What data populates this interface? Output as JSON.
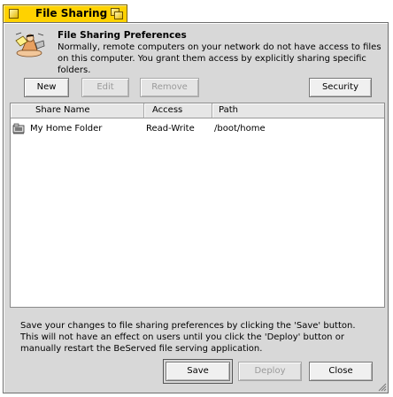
{
  "window": {
    "title": "File Sharing"
  },
  "header": {
    "title": "File Sharing Preferences",
    "description": "Normally, remote computers on your network do not have access to files on this computer.  You grant them access by explicitly sharing specific folders."
  },
  "toolbar": {
    "new_label": "New",
    "edit_label": "Edit",
    "remove_label": "Remove",
    "security_label": "Security"
  },
  "table": {
    "columns": [
      "Share Name",
      "Access",
      "Path"
    ],
    "rows": [
      {
        "name": "My Home Folder",
        "access": "Read-Write",
        "path": "/boot/home"
      }
    ]
  },
  "footer": {
    "note": "Save your changes to file sharing preferences by clicking the 'Save' button.  This will not have an effect on users until you click the 'Deploy' button or manually restart the BeServed file serving application.",
    "save_label": "Save",
    "deploy_label": "Deploy",
    "close_label": "Close"
  },
  "icons": {
    "header": "file-sharing-icon",
    "row": "shared-folder-icon"
  },
  "colors": {
    "title_tab": "#ffd200",
    "window_bg": "#d8d8d8",
    "disabled_text": "#9a9a9a"
  }
}
